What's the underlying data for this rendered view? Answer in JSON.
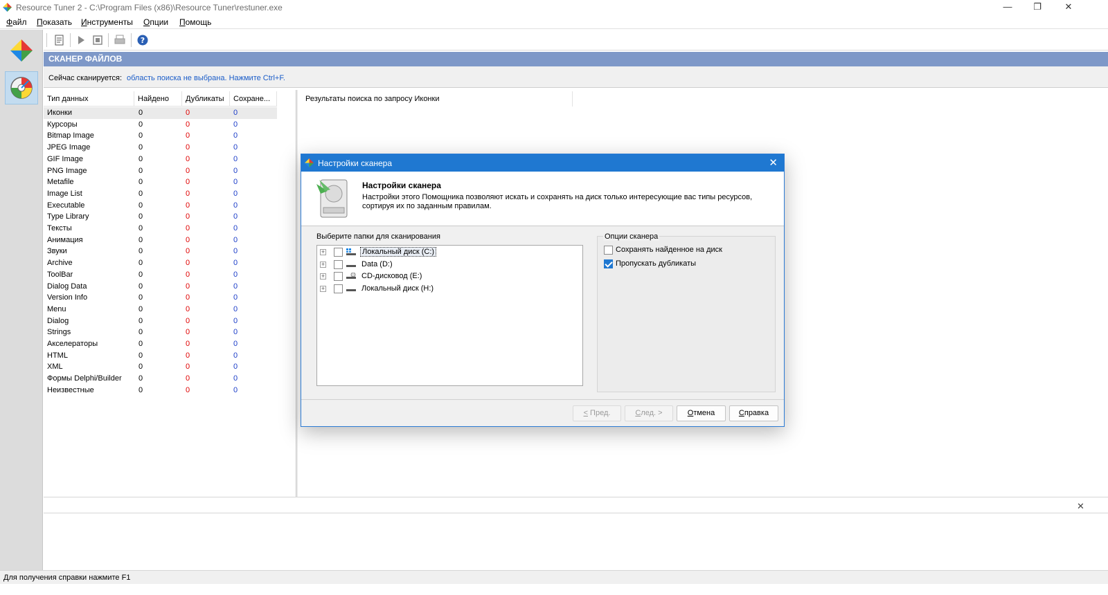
{
  "window": {
    "title": "Resource Tuner 2 - C:\\Program Files (x86)\\Resource Tuner\\restuner.exe",
    "minimize": "—",
    "restore": "❐",
    "close": "✕"
  },
  "menu": [
    "Файл",
    "Показать",
    "Инструменты",
    "Опции",
    "Помощь"
  ],
  "section": {
    "title": "СКАНЕР ФАЙЛОВ",
    "scan_label": "Сейчас сканируется:",
    "scan_value": "область поиска не выбрана. Нажмите Ctrl+F."
  },
  "table": {
    "headers": [
      "Тип данных",
      "Найдено",
      "Дубликаты",
      "Сохране..."
    ],
    "rows": [
      {
        "type": "Иконки",
        "found": "0",
        "dup": "0",
        "saved": "0"
      },
      {
        "type": "Курсоры",
        "found": "0",
        "dup": "0",
        "saved": "0"
      },
      {
        "type": "Bitmap Image",
        "found": "0",
        "dup": "0",
        "saved": "0"
      },
      {
        "type": "JPEG Image",
        "found": "0",
        "dup": "0",
        "saved": "0"
      },
      {
        "type": "GIF Image",
        "found": "0",
        "dup": "0",
        "saved": "0"
      },
      {
        "type": "PNG Image",
        "found": "0",
        "dup": "0",
        "saved": "0"
      },
      {
        "type": "Metafile",
        "found": "0",
        "dup": "0",
        "saved": "0"
      },
      {
        "type": "Image List",
        "found": "0",
        "dup": "0",
        "saved": "0"
      },
      {
        "type": "Executable",
        "found": "0",
        "dup": "0",
        "saved": "0"
      },
      {
        "type": "Type Library",
        "found": "0",
        "dup": "0",
        "saved": "0"
      },
      {
        "type": "Тексты",
        "found": "0",
        "dup": "0",
        "saved": "0"
      },
      {
        "type": "Анимация",
        "found": "0",
        "dup": "0",
        "saved": "0"
      },
      {
        "type": "Звуки",
        "found": "0",
        "dup": "0",
        "saved": "0"
      },
      {
        "type": "Archive",
        "found": "0",
        "dup": "0",
        "saved": "0"
      },
      {
        "type": "ToolBar",
        "found": "0",
        "dup": "0",
        "saved": "0"
      },
      {
        "type": "Dialog Data",
        "found": "0",
        "dup": "0",
        "saved": "0"
      },
      {
        "type": "Version Info",
        "found": "0",
        "dup": "0",
        "saved": "0"
      },
      {
        "type": "Menu",
        "found": "0",
        "dup": "0",
        "saved": "0"
      },
      {
        "type": "Dialog",
        "found": "0",
        "dup": "0",
        "saved": "0"
      },
      {
        "type": "Strings",
        "found": "0",
        "dup": "0",
        "saved": "0"
      },
      {
        "type": "Акселераторы",
        "found": "0",
        "dup": "0",
        "saved": "0"
      },
      {
        "type": "HTML",
        "found": "0",
        "dup": "0",
        "saved": "0"
      },
      {
        "type": "XML",
        "found": "0",
        "dup": "0",
        "saved": "0"
      },
      {
        "type": "Формы Delphi/Builder",
        "found": "0",
        "dup": "0",
        "saved": "0"
      },
      {
        "type": "Неизвестные",
        "found": "0",
        "dup": "0",
        "saved": "0"
      }
    ]
  },
  "results": {
    "header": "Результаты поиска по запросу Иконки"
  },
  "bottom_panel": {
    "close": "✕"
  },
  "status": {
    "text": "Для получения справки нажмите F1"
  },
  "dialog": {
    "title": "Настройки сканера",
    "close": "✕",
    "heading": "Настройки сканера",
    "description": "Настройки этого Помощника позволяют искать и сохранять на диск только интересующие вас типы ресурсов, сортируя их по заданным правилам.",
    "folders_label": "Выберите папки для сканирования",
    "drives": [
      {
        "label": "Локальный диск (C:)",
        "icon": "windows-drive-icon"
      },
      {
        "label": "Data (D:)",
        "icon": "hard-drive-icon"
      },
      {
        "label": "CD-дисковод (E:)",
        "icon": "cd-drive-icon"
      },
      {
        "label": "Локальный диск (H:)",
        "icon": "hard-drive-icon"
      }
    ],
    "options_label": "Опции сканера",
    "options": [
      {
        "label": "Сохранять найденное на диск",
        "checked": false
      },
      {
        "label": "Пропускать дубликаты",
        "checked": true
      }
    ],
    "buttons": {
      "prev": "< Пред.",
      "next": "След. >",
      "cancel": "Отмена",
      "help": "Справка"
    }
  },
  "colors": {
    "section_header": "#7e98c8",
    "dialog_title": "#1f78d1",
    "dup_value": "#e00000",
    "saved_value": "#1a3cc8",
    "link": "#1a5cc8"
  }
}
